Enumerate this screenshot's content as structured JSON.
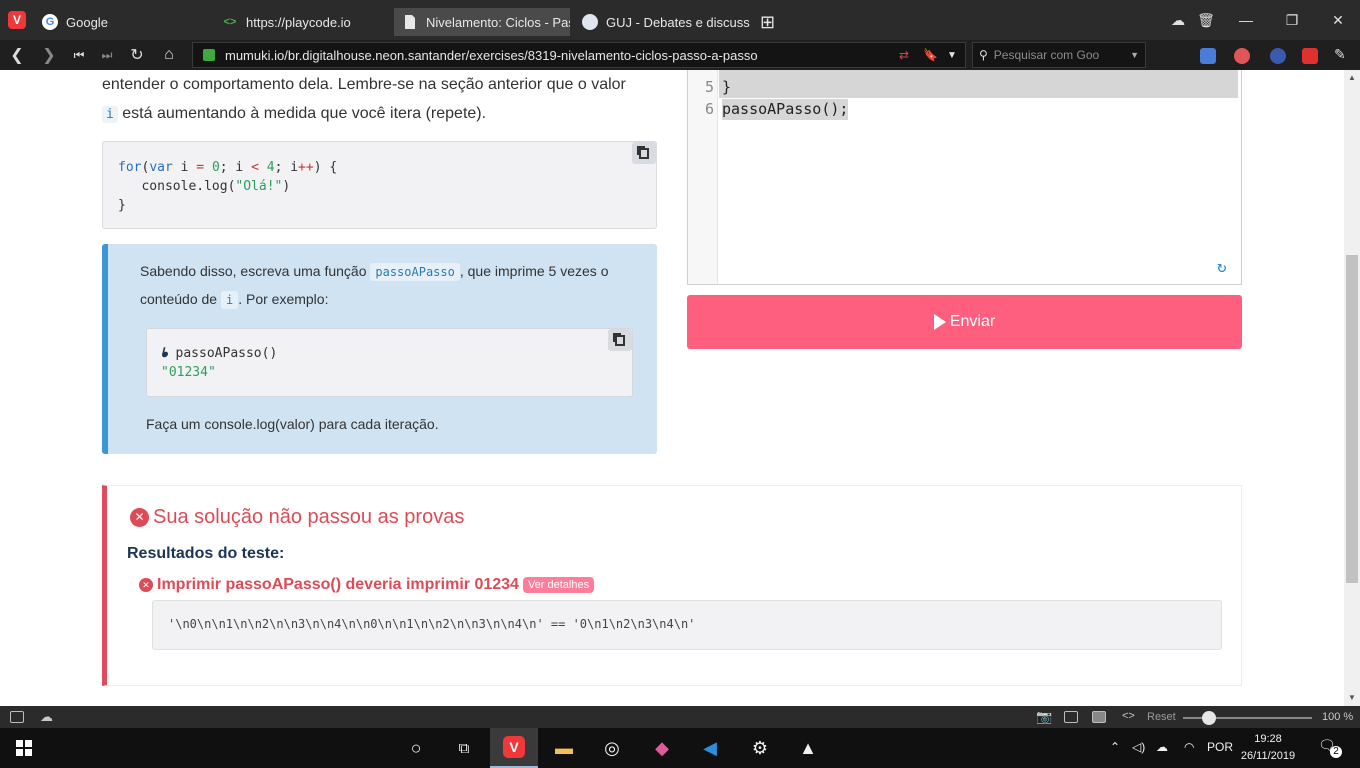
{
  "browser": {
    "tabs": [
      {
        "title": "Google",
        "icon": "google-icon"
      },
      {
        "title": "https://playcode.io",
        "icon": "playcode-icon"
      },
      {
        "title": "Nivelamento: Ciclos - Passo",
        "icon": "document-icon"
      },
      {
        "title": "GUJ - Debates e discussões",
        "icon": "guj-icon"
      }
    ],
    "url": "mumuki.io/br.digitalhouse.neon.santander/exercises/8319-nivelamento-ciclos-passo-a-passo",
    "search_placeholder": "Pesquisar com Goo"
  },
  "content": {
    "intro_part1": "entender o comportamento dela. Lembre-se na seção anterior que o valor",
    "intro_var": "i",
    "intro_part2": "está aumentando à medida que você itera (repete).",
    "code_example": {
      "line1_for": "for",
      "line1_var": "var",
      "line1_a": " i ",
      "line1_eq": "=",
      "line1_0": "0",
      "line1_b": "; i ",
      "line1_lt": "<",
      "line1_4": "4",
      "line1_c": "; i",
      "line1_pp": "++",
      "line1_d": ") {",
      "line2_a": "   console.log(",
      "line2_str": "\"Olá!\"",
      "line2_b": ")",
      "line3": "}"
    },
    "exercise": {
      "text1": "Sabendo disso, escreva uma função",
      "func": "passoAPasso",
      "text2": ", que imprime 5 vezes o",
      "text3": "conteúdo de",
      "var": "i",
      "text4": ". Por exemplo:",
      "example_call": "passoAPasso()",
      "example_result": "\"01234\"",
      "footer": "Faça um console.log(valor) para cada iteração."
    },
    "editor": {
      "lines": [
        {
          "no": "5",
          "code": "}"
        },
        {
          "no": "6",
          "code": "passoAPasso();"
        }
      ]
    },
    "submit_label": "Enviar",
    "results": {
      "title": "Sua solução não passou as provas",
      "subtitle": "Resultados do teste:",
      "test_name": "Imprimir passoAPasso() deveria imprimir 01234",
      "details_label": "Ver detalhes",
      "output": "'\\n0\\n\\n1\\n\\n2\\n\\n3\\n\\n4\\n\\n0\\n\\n1\\n\\n2\\n\\n3\\n\\n4\\n' == '0\\n1\\n2\\n3\\n4\\n'"
    }
  },
  "statusbar": {
    "reset_label": "Reset",
    "zoom": "100 %"
  },
  "taskbar": {
    "language": "POR",
    "time": "19:28",
    "date": "26/11/2019",
    "notifications": "2"
  },
  "colors": {
    "accent_pink": "#ff5f7e",
    "error_red": "#dd4b57",
    "info_blue": "#3d97d5"
  }
}
